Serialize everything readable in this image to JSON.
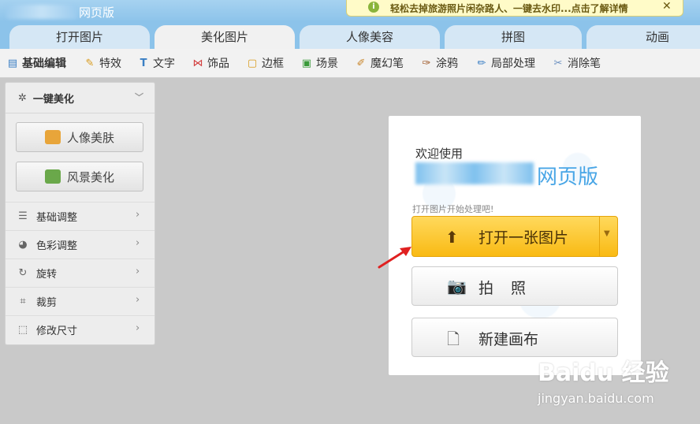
{
  "window": {
    "title": "网页版"
  },
  "promo": {
    "text": "轻松去掉旅游照片闲杂路人、一键去水印...点击了解详情",
    "close": "✕",
    "info_icon": "i"
  },
  "tabs": [
    {
      "label": "打开图片",
      "active": false
    },
    {
      "label": "美化图片",
      "active": true
    },
    {
      "label": "人像美容",
      "active": false
    },
    {
      "label": "拼图",
      "active": false
    },
    {
      "label": "动画",
      "active": false
    }
  ],
  "toolbar": [
    {
      "label": "基础编辑",
      "icon": "edit-icon",
      "active": true
    },
    {
      "label": "特效",
      "icon": "brush-icon",
      "active": false
    },
    {
      "label": "文字",
      "icon": "text-icon",
      "active": false
    },
    {
      "label": "饰品",
      "icon": "bow-icon",
      "active": false
    },
    {
      "label": "边框",
      "icon": "frame-icon",
      "active": false
    },
    {
      "label": "场景",
      "icon": "scene-icon",
      "active": false
    },
    {
      "label": "魔幻笔",
      "icon": "magic-pen-icon",
      "active": false
    },
    {
      "label": "涂鸦",
      "icon": "paint-brush-icon",
      "active": false
    },
    {
      "label": "局部处理",
      "icon": "local-edit-icon",
      "active": false
    },
    {
      "label": "消除笔",
      "icon": "eraser-icon",
      "active": false
    }
  ],
  "panel": {
    "title": "一键美化",
    "btn_portrait": "人像美肤",
    "btn_scenery": "风景美化",
    "items": [
      {
        "label": "基础调整",
        "icon": "sliders-icon"
      },
      {
        "label": "色彩调整",
        "icon": "palette-icon"
      },
      {
        "label": "旋转",
        "icon": "rotate-icon"
      },
      {
        "label": "裁剪",
        "icon": "crop-icon"
      },
      {
        "label": "修改尺寸",
        "icon": "resize-icon"
      }
    ]
  },
  "welcome": {
    "greeting": "欢迎使用",
    "product": "网页版",
    "tip": "打开图片开始处理吧!",
    "open_btn": "打开一张图片",
    "photo_btn": "拍照",
    "new_btn": "新建画布"
  },
  "watermark": {
    "main": "Baidu 经验",
    "sub": "jingyan.baidu.com"
  },
  "colors": {
    "accent_blue": "#8cc3ea",
    "open_btn": "#f9ba14",
    "arrow_red": "#e02020"
  }
}
